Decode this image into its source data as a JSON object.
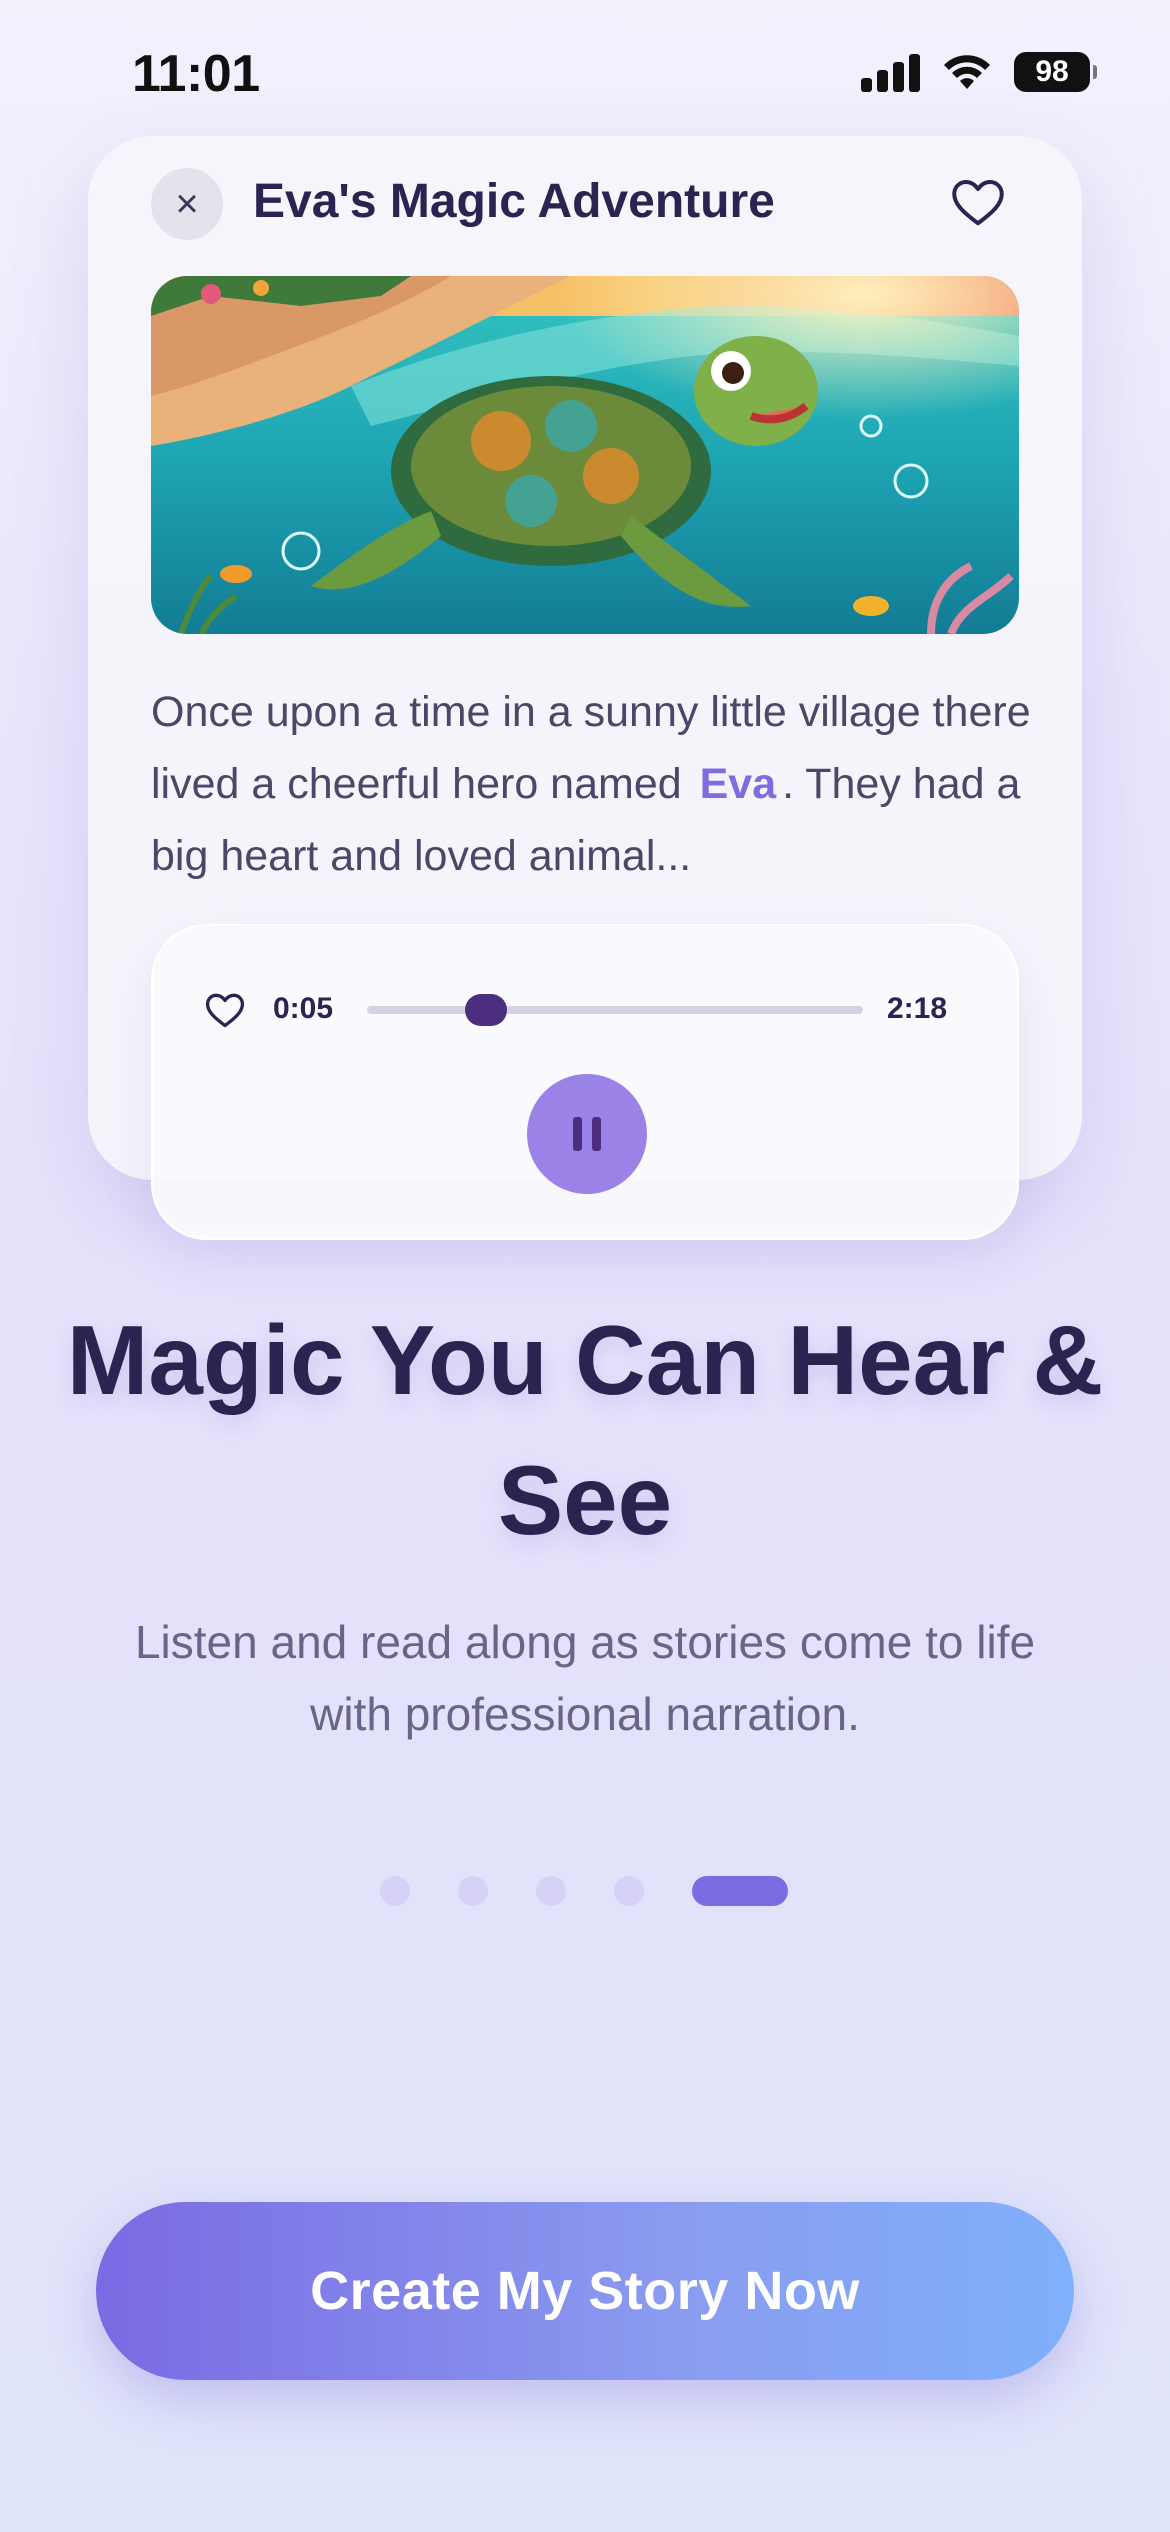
{
  "status_bar": {
    "time": "11:01",
    "battery": "98",
    "icons": [
      "cellular-signal-icon",
      "wifi-icon",
      "battery-icon"
    ]
  },
  "story_card": {
    "close_icon": "×",
    "title": "Eva's Magic Adventure",
    "favorite_icon": "heart-outline-icon",
    "image_description": "sea-turtle-illustration",
    "text_before_name": "Once upon a time in a sunny little village there lived a cheerful hero named",
    "hero_name": "Eva",
    "text_after_name": ". They had a big heart and loved animal..."
  },
  "player": {
    "current_time": "0:05",
    "total_time": "2:18",
    "progress": 0.24,
    "play_state": "playing",
    "icons": [
      "heart-outline-icon",
      "pause-icon"
    ]
  },
  "headline": "Magic You Can Hear & See",
  "subtitle": "Listen and read along as stories come to life with professional narration.",
  "pagination": {
    "total": 5,
    "active_index": 4
  },
  "cta_label": "Create My Story Now",
  "colors": {
    "accent": "#7c6ce1",
    "title": "#2b2350",
    "thumb": "#4b2f7e",
    "cta_start": "#7a6ae3",
    "cta_end": "#7fb0fc"
  }
}
